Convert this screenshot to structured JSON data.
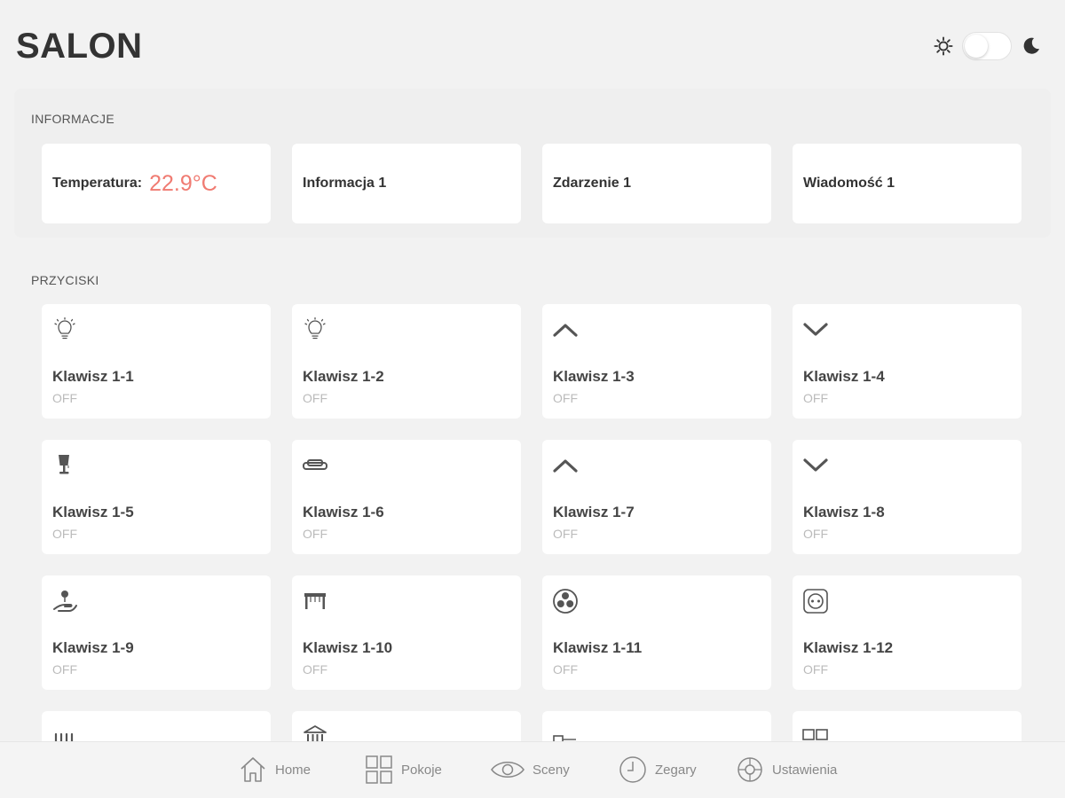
{
  "header": {
    "title": "SALON"
  },
  "info": {
    "label": "INFORMACJE",
    "cards": [
      {
        "label": "Temperatura:",
        "value": "22.9°C"
      },
      {
        "label": "Informacja 1"
      },
      {
        "label": "Zdarzenie 1"
      },
      {
        "label": "Wiadomość 1"
      }
    ]
  },
  "buttons": {
    "label": "PRZYCISKI",
    "tiles": [
      {
        "name": "Klawisz 1-1",
        "state": "OFF",
        "icon": "bulb-icon"
      },
      {
        "name": "Klawisz 1-2",
        "state": "OFF",
        "icon": "bulb-icon"
      },
      {
        "name": "Klawisz 1-3",
        "state": "OFF",
        "icon": "chevron-up-icon"
      },
      {
        "name": "Klawisz 1-4",
        "state": "OFF",
        "icon": "chevron-down-icon"
      },
      {
        "name": "Klawisz 1-5",
        "state": "OFF",
        "icon": "table-lamp-icon"
      },
      {
        "name": "Klawisz 1-6",
        "state": "OFF",
        "icon": "sofa-icon"
      },
      {
        "name": "Klawisz 1-7",
        "state": "OFF",
        "icon": "chevron-up-icon"
      },
      {
        "name": "Klawisz 1-8",
        "state": "OFF",
        "icon": "chevron-down-icon"
      },
      {
        "name": "Klawisz 1-9",
        "state": "OFF",
        "icon": "hand-light-icon"
      },
      {
        "name": "Klawisz 1-10",
        "state": "OFF",
        "icon": "awning-icon"
      },
      {
        "name": "Klawisz 1-11",
        "state": "OFF",
        "icon": "fan-icon"
      },
      {
        "name": "Klawisz 1-12",
        "state": "OFF",
        "icon": "socket-icon"
      },
      {
        "name": "",
        "state": "",
        "icon": "radiator-icon"
      },
      {
        "name": "",
        "state": "",
        "icon": "building-icon"
      },
      {
        "name": "",
        "state": "",
        "icon": "heater-icon"
      },
      {
        "name": "",
        "state": "",
        "icon": "window-icon"
      }
    ]
  },
  "nav": {
    "items": [
      {
        "label": "Home",
        "icon": "home-icon"
      },
      {
        "label": "Pokoje",
        "icon": "rooms-grid-icon"
      },
      {
        "label": "Sceny",
        "icon": "eye-icon"
      },
      {
        "label": "Zegary",
        "icon": "clock-icon"
      },
      {
        "label": "Ustawienia",
        "icon": "settings-icon"
      }
    ]
  },
  "colors": {
    "accent": "#f07b72",
    "background": "#f2f2f2",
    "card": "#ffffff"
  }
}
